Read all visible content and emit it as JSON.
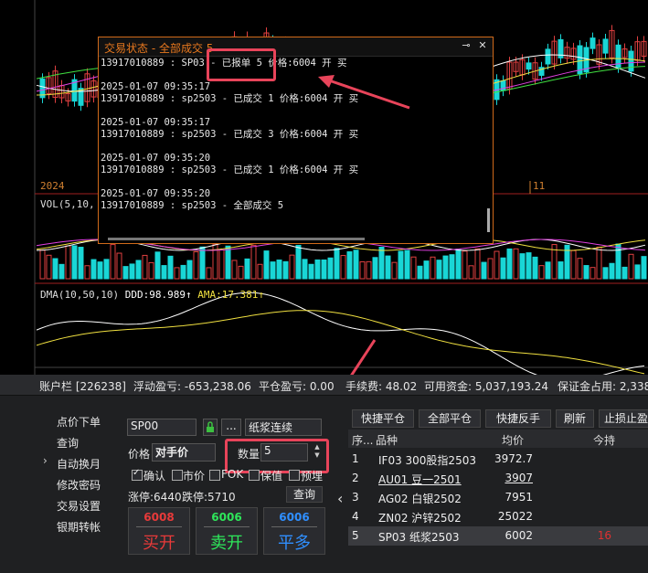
{
  "chart": {
    "year_label": "2024",
    "month_label": "11",
    "vol_label": "VOL(5,10,",
    "dma_label_1": "DMA(10,50,10)",
    "dma_label_2": "DDD:98.989",
    "dma_arrow_1": "↑",
    "dma_label_3": "AMA:17.381",
    "dma_arrow_2": "↑",
    "up_color": "#e04040",
    "down_color": "#19d6d6"
  },
  "popup": {
    "title": "交易状态 - 全部成交 5",
    "pin_icon": "pin-icon",
    "close_icon": "close-icon",
    "lines": [
      "13917010889 : SP03 - 已报单 5 价格:6004 开 买",
      "",
      "2025-01-07 09:35:17",
      "13917010889 : sp2503 - 已成交 1 价格:6004 开 买",
      "",
      "2025-01-07 09:35:17",
      "13917010889 : sp2503 - 已成交 3 价格:6004 开 买",
      "",
      "2025-01-07 09:35:20",
      "13917010889 : sp2503 - 已成交 1 价格:6004 开 买",
      "",
      "2025-01-07 09:35:20",
      "13917010889 : sp2503 - 全部成交 5"
    ]
  },
  "statusbar": {
    "account": "账户栏 [226238]",
    "floating_pl": "浮动盈亏: -653,238.06",
    "close_pl": "平仓盈亏: 0.00",
    "fee": "手续费: 48.02",
    "available": "可用资金: 5,037,193.24",
    "margin": "保证金占用: 2,338"
  },
  "nav": {
    "items": [
      "点价下单",
      "查询",
      "自动换月",
      "修改密码",
      "交易设置",
      "银期转帐"
    ],
    "chevron": "›"
  },
  "order": {
    "contract_code": "SP00",
    "lock_icon": "lock-icon",
    "more_label": "...",
    "contract_name": "纸浆连续",
    "price_label": "价格",
    "price_value": "对手价",
    "qty_label": "数量",
    "qty_value": "5",
    "options": [
      "确认",
      "市价",
      "FOK",
      "保值",
      "预埋"
    ],
    "limit_up": "涨停:6440",
    "limit_down": "跌停:5710",
    "query_button": "查询",
    "buy_price": "6008",
    "buy_label": "买开",
    "sell_price": "6006",
    "sell_label": "卖开",
    "flat_price": "6006",
    "flat_label": "平多",
    "buy_color": "#e83a3a",
    "sell_color": "#2ee65a",
    "flat_color": "#2f8fff"
  },
  "toolbar": {
    "collapse": "‹",
    "buttons": [
      "快捷平仓",
      "全部平仓",
      "快捷反手",
      "刷新",
      "止损止盈"
    ]
  },
  "table": {
    "headers": [
      "序...",
      "品种",
      "均价",
      "今持"
    ],
    "rows": [
      {
        "idx": "1",
        "name": "IF03 300股指2503",
        "avg": "3972.7",
        "today": ""
      },
      {
        "idx": "2",
        "name": "AU01 豆一2501",
        "avg": "3907",
        "today": ""
      },
      {
        "idx": "3",
        "name": "AG02 白银2502",
        "avg": "7951",
        "today": ""
      },
      {
        "idx": "4",
        "name": "ZN02 沪锌2502",
        "avg": "25022",
        "today": ""
      },
      {
        "idx": "5",
        "name": "SP03 纸浆2503",
        "avg": "6002",
        "today": "16"
      }
    ]
  }
}
